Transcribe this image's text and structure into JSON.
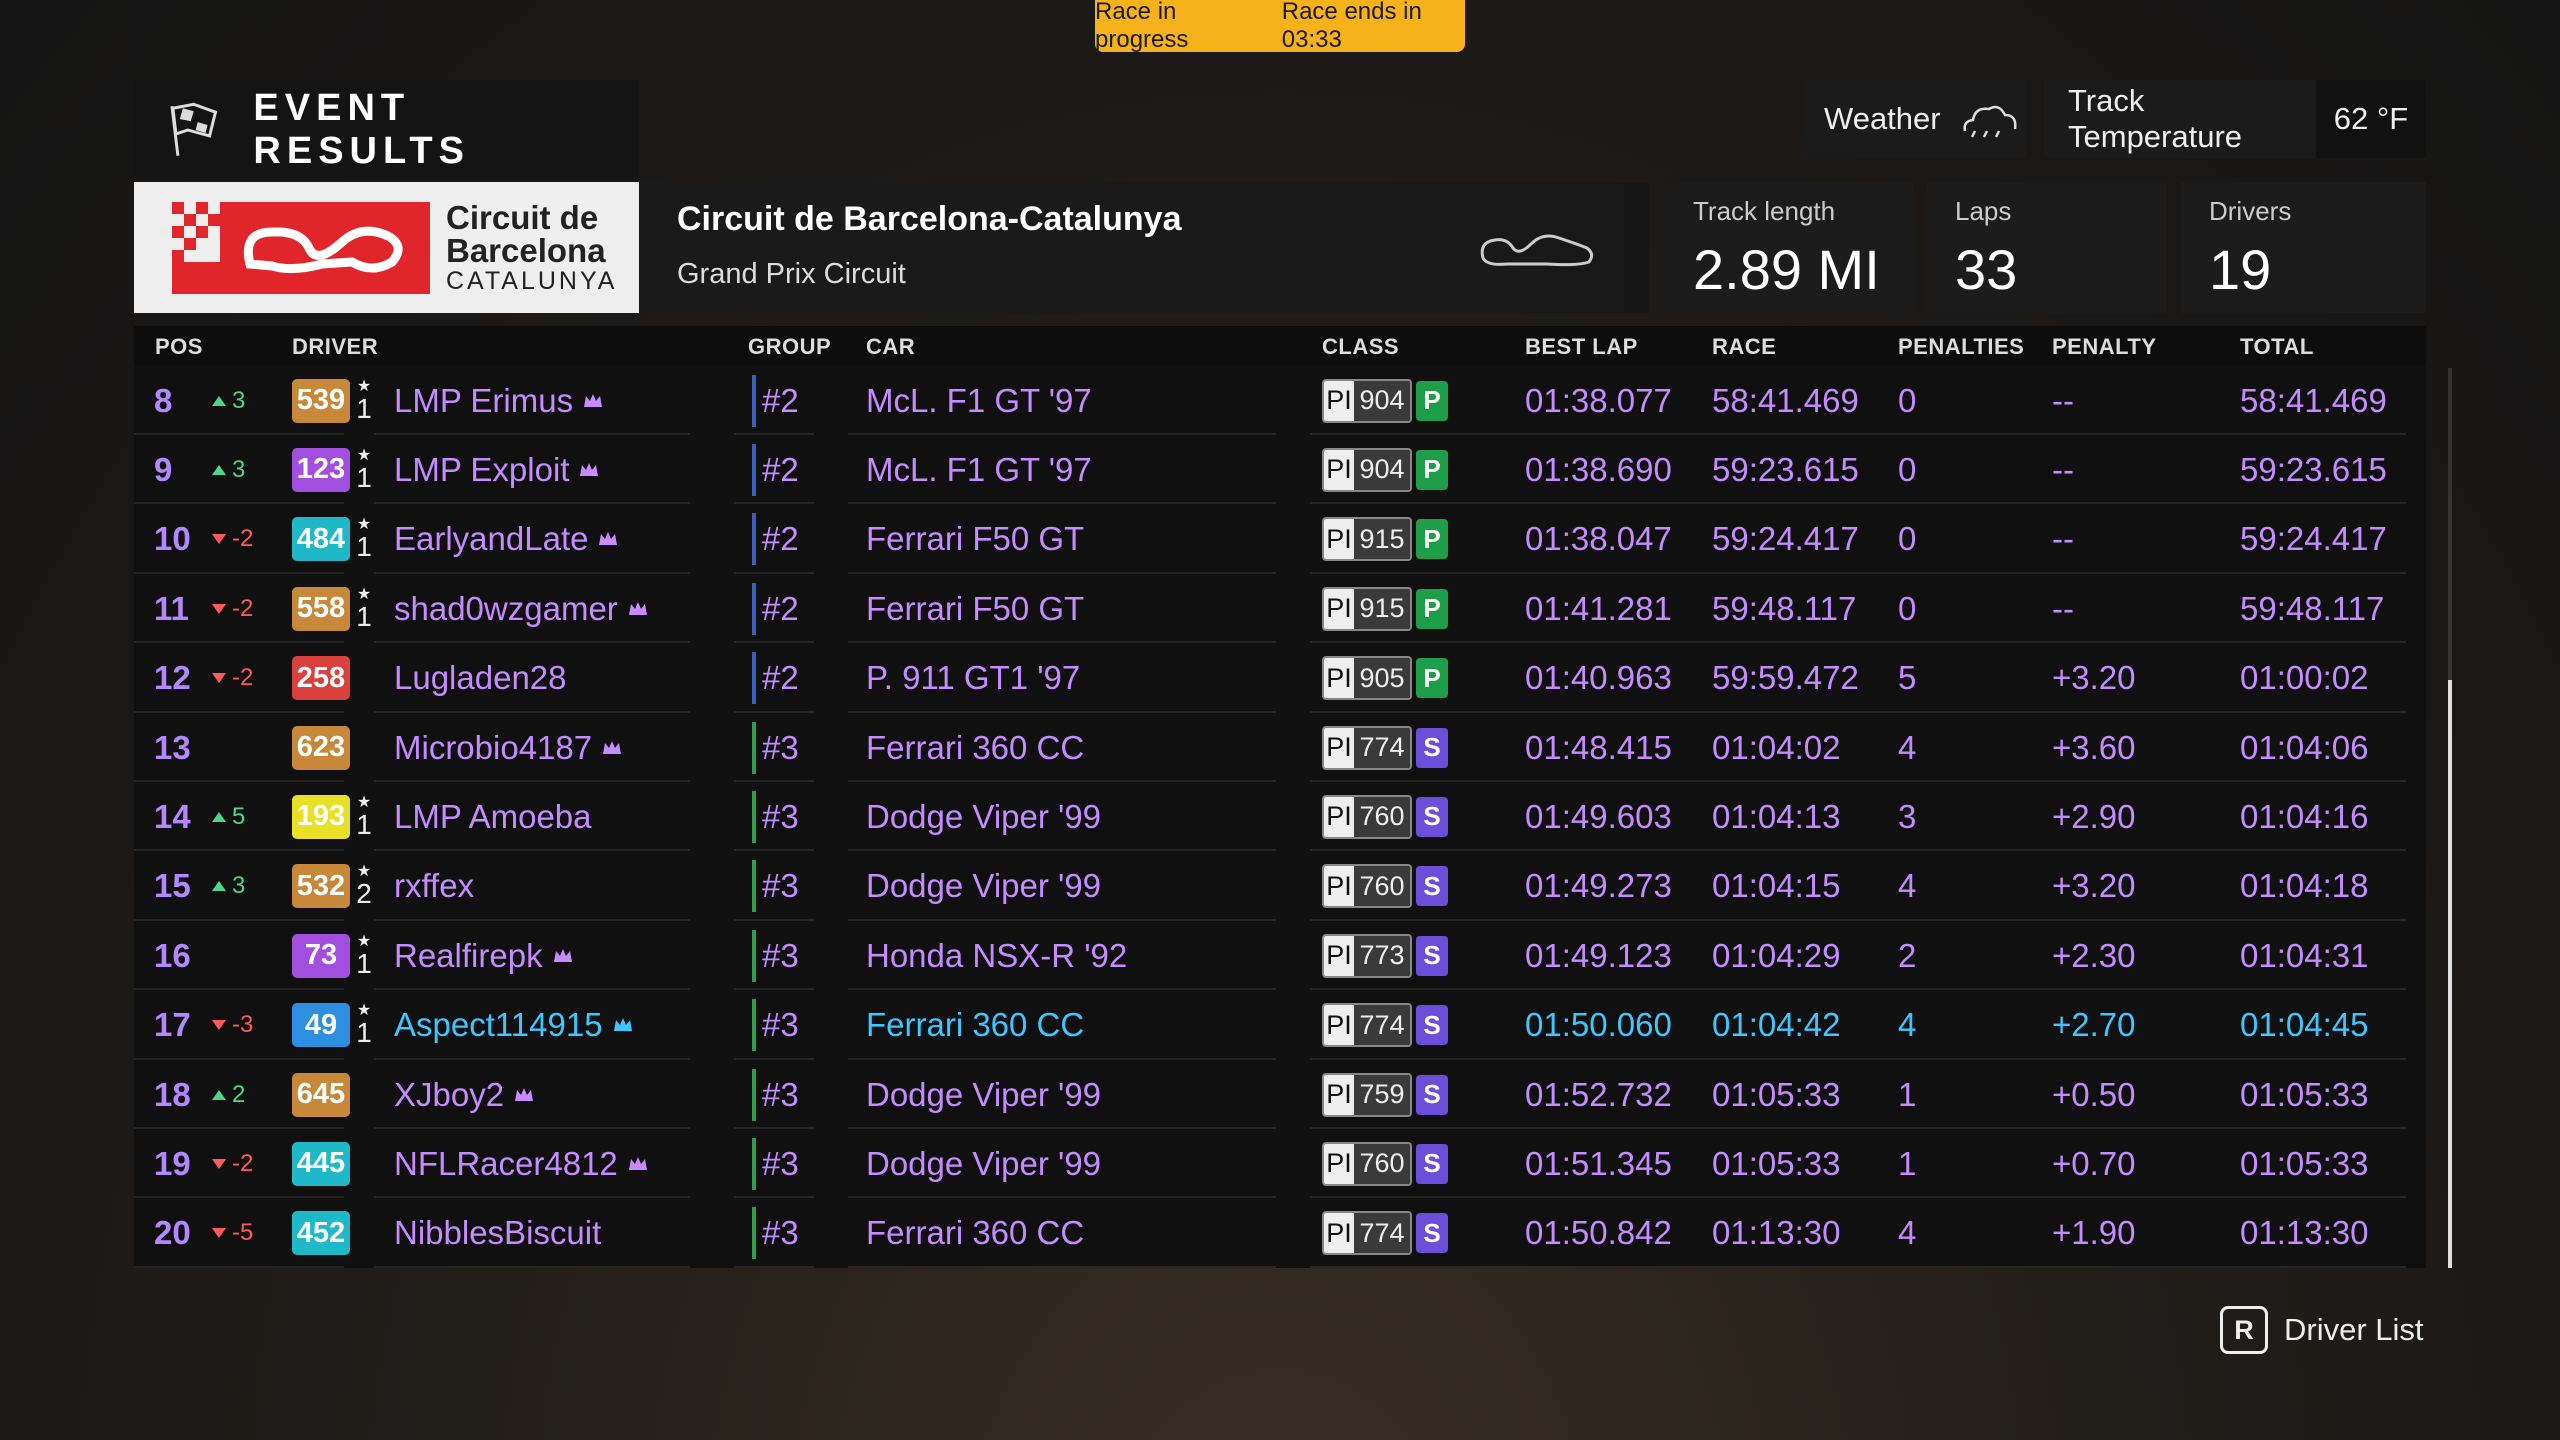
{
  "banner": {
    "status": "Race in progress",
    "ends": "Race ends in 03:33"
  },
  "header": {
    "title": "EVENT RESULTS",
    "weather_label": "Weather",
    "weather_icon": "cloud-icon",
    "temp_label": "Track Temperature",
    "temp_value": "62 °F"
  },
  "track": {
    "logo_line1": "Circuit de",
    "logo_line2": "Barcelona",
    "logo_line3": "CATALUNYA",
    "name": "Circuit de Barcelona-Catalunya",
    "layout": "Grand Prix Circuit",
    "length_label": "Track length",
    "length_value": "2.89 MI",
    "laps_label": "Laps",
    "laps_value": "33",
    "drivers_label": "Drivers",
    "drivers_value": "19"
  },
  "columns": {
    "pos": "POS",
    "driver": "DRIVER",
    "group": "GROUP",
    "car": "CAR",
    "class": "CLASS",
    "best_lap": "BEST LAP",
    "race": "RACE",
    "penalties": "PENALTIES",
    "penalty": "PENALTY",
    "total": "TOTAL"
  },
  "colors": {
    "accent": "#f5b21b",
    "class_p": "#1f9e4a",
    "class_s": "#6a4fd8",
    "group2": "#3a5fb8",
    "group3": "#2e9e4a",
    "highlight": "#3ec6ff"
  },
  "rows": [
    {
      "pos": "8",
      "chg": "3",
      "dir": "up",
      "level": "539",
      "lvl_color": "#c8883a",
      "rank": "1",
      "driver": "LMP Erimus",
      "crown": true,
      "group": "#2",
      "car": "McL. F1 GT '97",
      "pi_label": "PI",
      "pi": "904",
      "cls": "P",
      "best": "01:38.077",
      "race": "58:41.469",
      "pens": "0",
      "penalty": "--",
      "total": "58:41.469"
    },
    {
      "pos": "9",
      "chg": "3",
      "dir": "up",
      "level": "123",
      "lvl_color": "#a24fe0",
      "rank": "1",
      "driver": "LMP Exploit",
      "crown": true,
      "group": "#2",
      "car": "McL. F1 GT '97",
      "pi_label": "PI",
      "pi": "904",
      "cls": "P",
      "best": "01:38.690",
      "race": "59:23.615",
      "pens": "0",
      "penalty": "--",
      "total": "59:23.615"
    },
    {
      "pos": "10",
      "chg": "-2",
      "dir": "down",
      "level": "484",
      "lvl_color": "#1fb8c8",
      "rank": "1",
      "driver": "EarlyandLate",
      "crown": true,
      "group": "#2",
      "car": "Ferrari F50 GT",
      "pi_label": "PI",
      "pi": "915",
      "cls": "P",
      "best": "01:38.047",
      "race": "59:24.417",
      "pens": "0",
      "penalty": "--",
      "total": "59:24.417"
    },
    {
      "pos": "11",
      "chg": "-2",
      "dir": "down",
      "level": "558",
      "lvl_color": "#c8883a",
      "rank": "1",
      "driver": "shad0wzgamer",
      "crown": true,
      "group": "#2",
      "car": "Ferrari F50 GT",
      "pi_label": "PI",
      "pi": "915",
      "cls": "P",
      "best": "01:41.281",
      "race": "59:48.117",
      "pens": "0",
      "penalty": "--",
      "total": "59:48.117"
    },
    {
      "pos": "12",
      "chg": "-2",
      "dir": "down",
      "level": "258",
      "lvl_color": "#d9423c",
      "rank": "",
      "driver": "Lugladen28",
      "crown": false,
      "group": "#2",
      "car": "P. 911 GT1 '97",
      "pi_label": "PI",
      "pi": "905",
      "cls": "P",
      "best": "01:40.963",
      "race": "59:59.472",
      "pens": "5",
      "penalty": "+3.20",
      "total": "01:00:02"
    },
    {
      "pos": "13",
      "chg": "",
      "dir": "",
      "level": "623",
      "lvl_color": "#c8883a",
      "rank": "",
      "driver": "Microbio4187",
      "crown": true,
      "group": "#3",
      "car": "Ferrari 360 CC",
      "pi_label": "PI",
      "pi": "774",
      "cls": "S",
      "best": "01:48.415",
      "race": "01:04:02",
      "pens": "4",
      "penalty": "+3.60",
      "total": "01:04:06"
    },
    {
      "pos": "14",
      "chg": "5",
      "dir": "up",
      "level": "193",
      "lvl_color": "#e8e024",
      "rank": "1",
      "driver": "LMP Amoeba",
      "crown": false,
      "group": "#3",
      "car": "Dodge Viper '99",
      "pi_label": "PI",
      "pi": "760",
      "cls": "S",
      "best": "01:49.603",
      "race": "01:04:13",
      "pens": "3",
      "penalty": "+2.90",
      "total": "01:04:16"
    },
    {
      "pos": "15",
      "chg": "3",
      "dir": "up",
      "level": "532",
      "lvl_color": "#c8883a",
      "rank": "2",
      "driver": "rxffex",
      "crown": false,
      "group": "#3",
      "car": "Dodge Viper '99",
      "pi_label": "PI",
      "pi": "760",
      "cls": "S",
      "best": "01:49.273",
      "race": "01:04:15",
      "pens": "4",
      "penalty": "+3.20",
      "total": "01:04:18"
    },
    {
      "pos": "16",
      "chg": "",
      "dir": "",
      "level": "73",
      "lvl_color": "#a24fe0",
      "rank": "1",
      "driver": "Realfirepk",
      "crown": true,
      "group": "#3",
      "car": "Honda NSX-R '92",
      "pi_label": "PI",
      "pi": "773",
      "cls": "S",
      "best": "01:49.123",
      "race": "01:04:29",
      "pens": "2",
      "penalty": "+2.30",
      "total": "01:04:31"
    },
    {
      "pos": "17",
      "chg": "-3",
      "dir": "down",
      "level": "49",
      "lvl_color": "#2e8ee0",
      "rank": "1",
      "driver": "Aspect114915",
      "crown": true,
      "group": "#3",
      "car": "Ferrari 360 CC",
      "pi_label": "PI",
      "pi": "774",
      "cls": "S",
      "best": "01:50.060",
      "race": "01:04:42",
      "pens": "4",
      "penalty": "+2.70",
      "total": "01:04:45",
      "highlight": true
    },
    {
      "pos": "18",
      "chg": "2",
      "dir": "up",
      "level": "645",
      "lvl_color": "#c8883a",
      "rank": "",
      "driver": "XJboy2",
      "crown": true,
      "group": "#3",
      "car": "Dodge Viper '99",
      "pi_label": "PI",
      "pi": "759",
      "cls": "S",
      "best": "01:52.732",
      "race": "01:05:33",
      "pens": "1",
      "penalty": "+0.50",
      "total": "01:05:33"
    },
    {
      "pos": "19",
      "chg": "-2",
      "dir": "down",
      "level": "445",
      "lvl_color": "#1fb8c8",
      "rank": "",
      "driver": "NFLRacer4812",
      "crown": true,
      "group": "#3",
      "car": "Dodge Viper '99",
      "pi_label": "PI",
      "pi": "760",
      "cls": "S",
      "best": "01:51.345",
      "race": "01:05:33",
      "pens": "1",
      "penalty": "+0.70",
      "total": "01:05:33"
    },
    {
      "pos": "20",
      "chg": "-5",
      "dir": "down",
      "level": "452",
      "lvl_color": "#1fb8c8",
      "rank": "",
      "driver": "NibblesBiscuit",
      "crown": false,
      "group": "#3",
      "car": "Ferrari 360 CC",
      "pi_label": "PI",
      "pi": "774",
      "cls": "S",
      "best": "01:50.842",
      "race": "01:13:30",
      "pens": "4",
      "penalty": "+1.90",
      "total": "01:13:30"
    }
  ],
  "footer": {
    "key": "R",
    "label": "Driver List"
  }
}
